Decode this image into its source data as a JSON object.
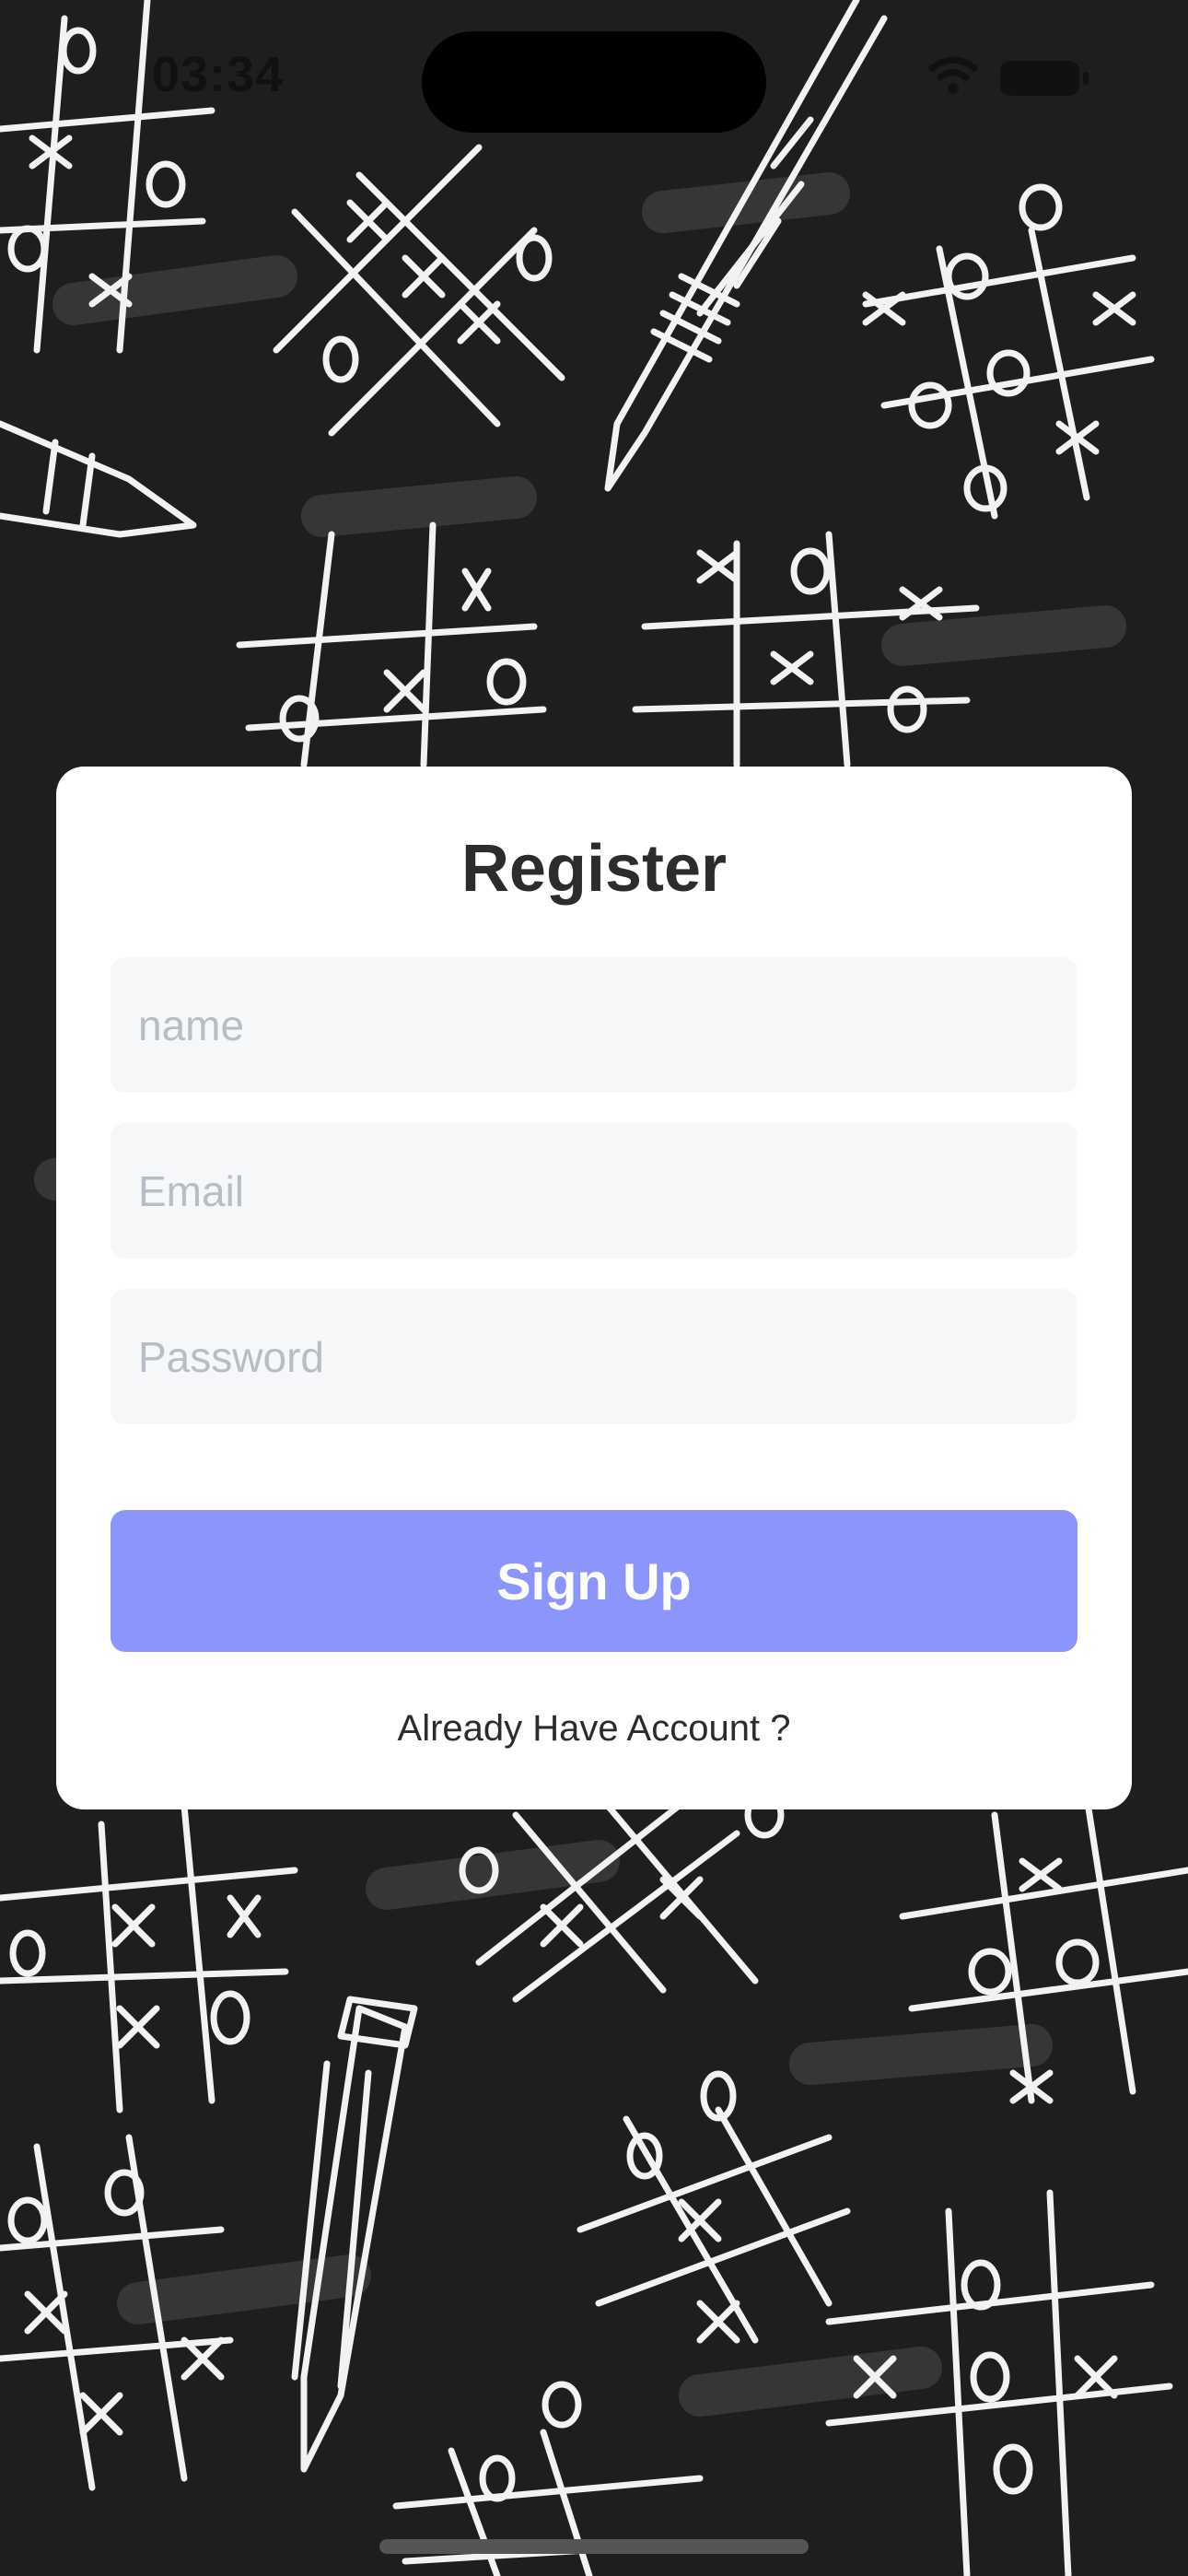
{
  "status_bar": {
    "time": "03:34"
  },
  "register": {
    "title": "Register",
    "name_placeholder": "name",
    "email_placeholder": "Email",
    "password_placeholder": "Password",
    "signup_label": "Sign Up",
    "already_link": "Already Have Account ?"
  },
  "colors": {
    "background": "#1f1e1f",
    "card": "#ffffff",
    "button": "#8b95fb",
    "field": "#f6f7f9"
  }
}
